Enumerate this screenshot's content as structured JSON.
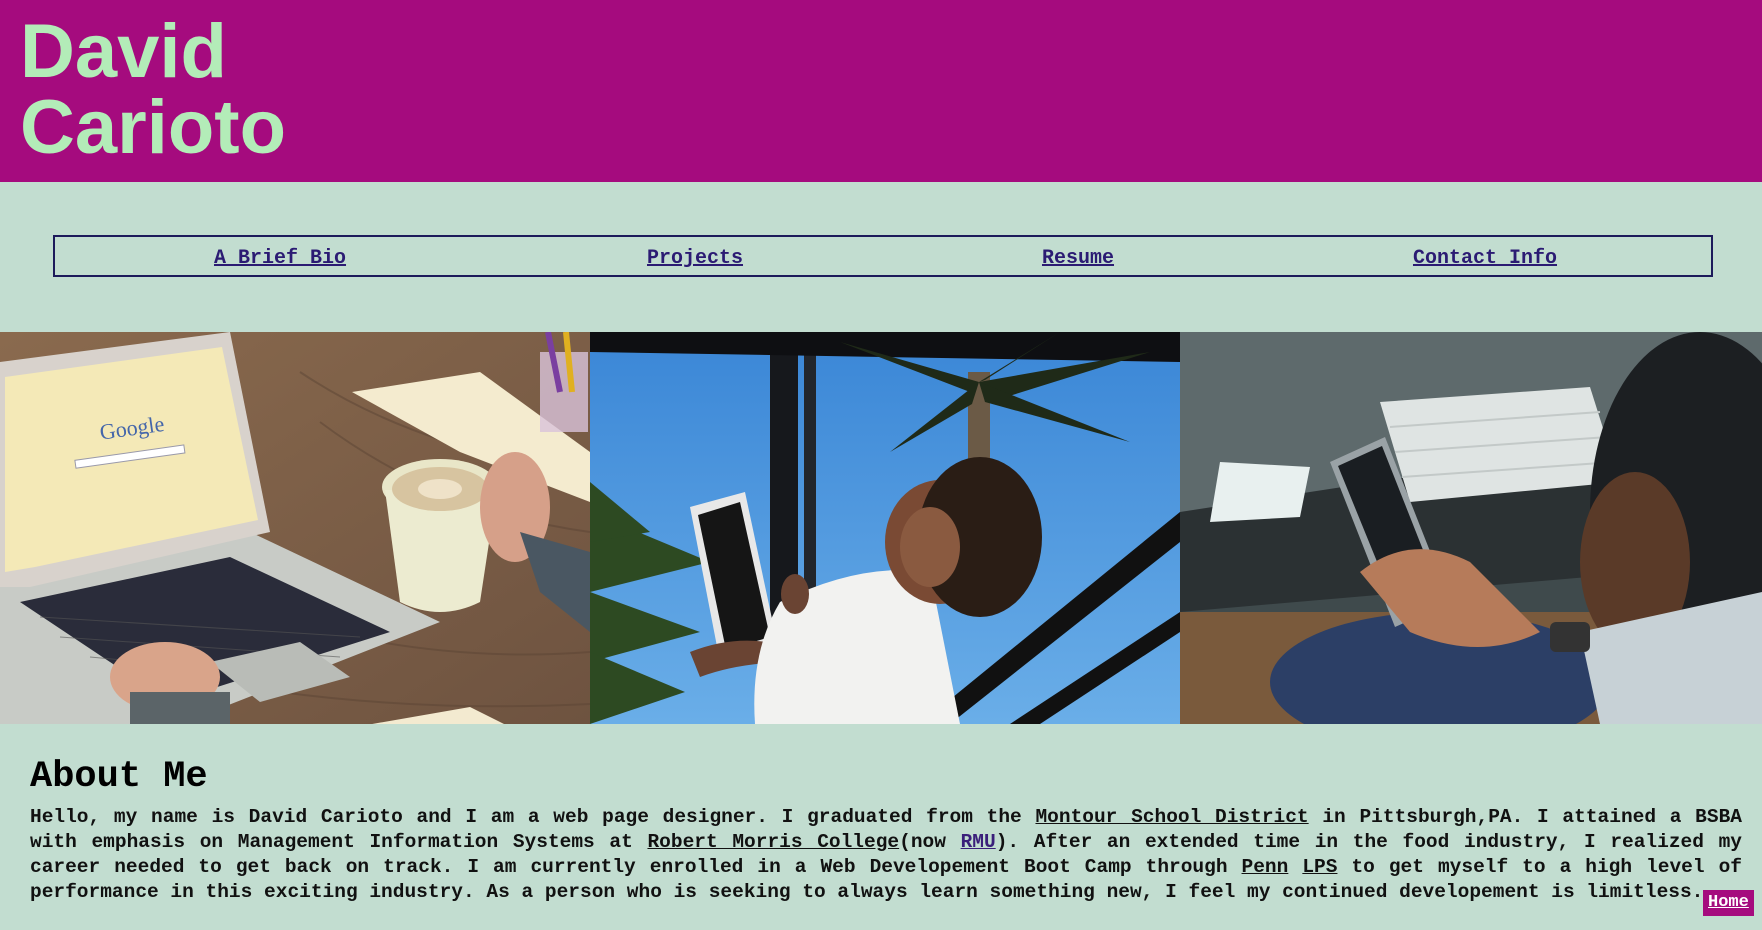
{
  "header": {
    "name_line1": "David",
    "name_line2": "Carioto",
    "background": "#a50b7e",
    "name_color": "#b3ecb8"
  },
  "nav": {
    "items": [
      {
        "label": "A Brief Bio"
      },
      {
        "label": "Projects"
      },
      {
        "label": "Resume"
      },
      {
        "label": "Contact Info"
      }
    ]
  },
  "photos": [
    {
      "subject": "laptop-coffee-photo",
      "google_text": "Google"
    },
    {
      "subject": "woman-tablet-photo"
    },
    {
      "subject": "person-phone-photo"
    }
  ],
  "about": {
    "title": "About Me",
    "p1": "Hello, my name is David Carioto and I am a web page designer. I graduated from the ",
    "link_school": "Montour School District",
    "p2": " in Pittsburgh,PA. I attained a BSBA with emphasis on Management Information Systems at ",
    "link_college": "Robert Morris College",
    "p3": "(now ",
    "link_rmu": "RMU",
    "p4": "). After an extended time in the food industry, I realized my career needed to get back on track. I am currently enrolled in a Web Developement Boot Camp through ",
    "link_penn": "Penn",
    "p5": " ",
    "link_lps": "LPS",
    "p6": " to get myself to a high level of performance in this exciting industry. As a person who is seeking to always learn something new, I feel my continued developement is limitless."
  },
  "footer": {
    "home_label": "Home"
  },
  "colors": {
    "page_background": "#c2ddd0",
    "nav_border": "#1c1a5a",
    "link": "#2b1b73"
  }
}
